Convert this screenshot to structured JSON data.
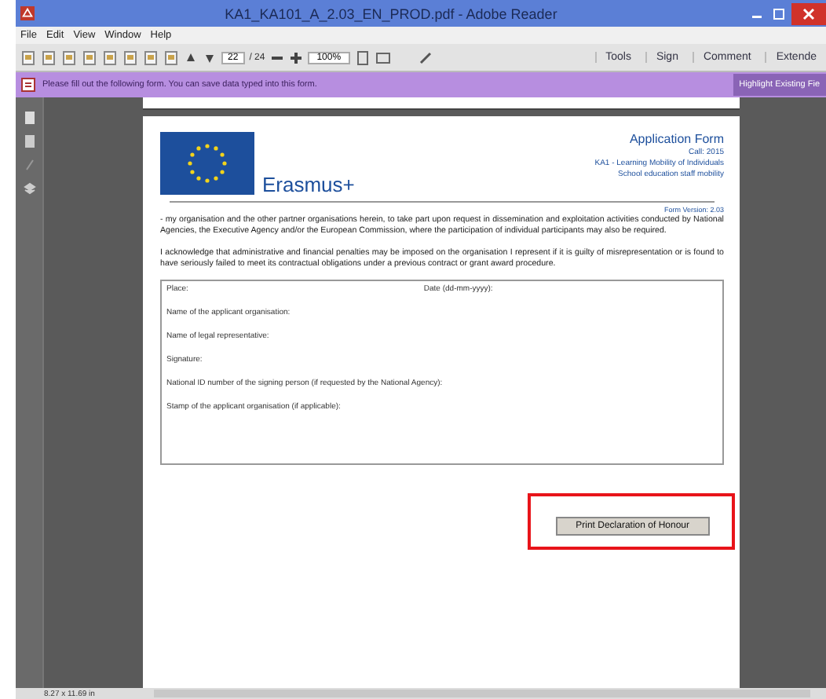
{
  "window": {
    "title": "KA1_KA101_A_2.03_EN_PROD.pdf - Adobe Reader"
  },
  "menu": [
    "File",
    "Edit",
    "View",
    "Window",
    "Help"
  ],
  "toolbar": {
    "page_number": "22",
    "page_total": "/ 24",
    "zoom": "100%",
    "panels": [
      "Tools",
      "Sign",
      "Comment",
      "Extende"
    ]
  },
  "notice": {
    "message": "Please fill out the following form. You can save data typed into this form.",
    "button": "Highlight Existing Fie"
  },
  "document": {
    "logo_text": "Erasmus+",
    "header": [
      "Application Form",
      "Call: 2015",
      "KA1 - Learning Mobility of Individuals",
      "School education staff mobility"
    ],
    "form_version": "Form Version: 2.03",
    "paragraphs": [
      "- my organisation and the other partner organisations herein, to take part upon request in dissemination and exploitation activities conducted by National Agencies, the Executive Agency and/or the European Commission, where the participation of individual participants may also be required.",
      "I acknowledge that administrative and financial penalties may be imposed on the organisation I represent if it is guilty of misrepresentation or is found to have seriously failed to meet its contractual obligations under a previous contract or grant award procedure."
    ],
    "fields": [
      [
        "Place:",
        "Date (dd-mm-yyyy):"
      ],
      [
        "Name of the applicant organisation:"
      ],
      [
        "Name of legal representative:"
      ],
      [
        "Signature:"
      ],
      [
        "National ID number of the signing person (if requested by the National Agency):"
      ],
      [
        "Stamp of the applicant organisation (if applicable):"
      ]
    ],
    "print_button": "Print Declaration of Honour",
    "print_button_highlighted": true
  },
  "status_bar": {
    "page_size": "8.27 x 11.69 in"
  }
}
